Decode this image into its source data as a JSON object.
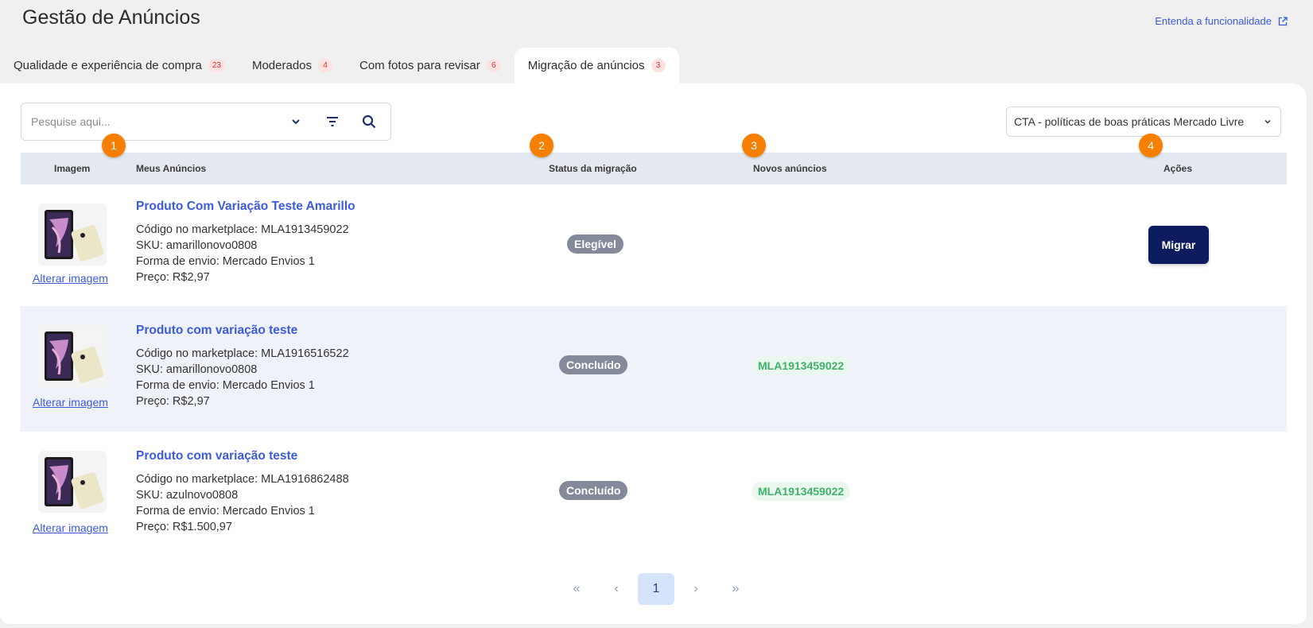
{
  "header": {
    "title": "Gestão de Anúncios",
    "help_link": "Entenda a funcionalidade"
  },
  "tabs": [
    {
      "label": "Qualidade e experiência de compra",
      "count": "23"
    },
    {
      "label": "Moderados",
      "count": "4"
    },
    {
      "label": "Com fotos para revisar",
      "count": "6"
    },
    {
      "label": "Migração de anúncios",
      "count": "3",
      "active": true
    }
  ],
  "search": {
    "placeholder": "Pesquise aqui..."
  },
  "cta_select": {
    "value": "CTA - políticas de boas práticas Mercado Livre"
  },
  "table": {
    "columns": [
      "Imagem",
      "Meus Anúncios",
      "Status da migração",
      "Novos anúncios",
      "Ações"
    ],
    "markers": [
      "1",
      "2",
      "3",
      "4"
    ],
    "rows": [
      {
        "title": "Produto Com Variação Teste Amarillo",
        "code": "Código no marketplace: MLA1913459022",
        "sku": "SKU: amarillonovo0808",
        "shipping": "Forma de envio: Mercado Envios 1",
        "price": "Preço: R$2,97",
        "status": "Elegível",
        "new_ad": "",
        "action": "Migrar",
        "change_image": "Alterar imagem"
      },
      {
        "title": "Produto com variação teste",
        "code": "Código no marketplace: MLA1916516522",
        "sku": "SKU: amarillonovo0808",
        "shipping": "Forma de envio: Mercado Envios 1",
        "price": "Preço: R$2,97",
        "status": "Concluído",
        "new_ad": "MLA1913459022",
        "action": "",
        "change_image": "Alterar imagem"
      },
      {
        "title": "Produto com variação teste",
        "code": "Código no marketplace: MLA1916862488",
        "sku": "SKU: azulnovo0808",
        "shipping": "Forma de envio: Mercado Envios 1",
        "price": "Preço: R$1.500,97",
        "status": "Concluído",
        "new_ad": "MLA1913459022",
        "action": "",
        "change_image": "Alterar imagem"
      }
    ]
  },
  "pagination": {
    "first": "«",
    "prev": "‹",
    "current": "1",
    "next": "›",
    "last": "»"
  },
  "colors": {
    "accent": "#3b5bdb",
    "primary_button": "#0c1c5e",
    "marker": "#f77f00",
    "status_badge": "#858a9b",
    "new_ad_text": "#40b36a",
    "tab_count": "#e03131"
  }
}
